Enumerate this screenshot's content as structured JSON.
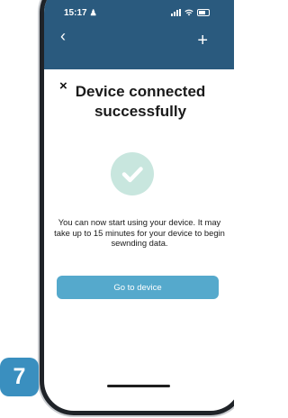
{
  "statusbar": {
    "time": "15:17",
    "person_glyph": "♟",
    "icons": [
      "signal-icon",
      "wifi-icon",
      "battery-icon"
    ]
  },
  "header": {
    "back_glyph": "‹",
    "add_glyph": "+",
    "background_color": "#2a5a7e"
  },
  "dialog": {
    "close_glyph": "×",
    "title": "Device connected successfully",
    "icon": "check-circle-icon",
    "icon_bg_color": "#c8e6de",
    "message": "You can now start using your device. It may take up to 15 minutes for your device to begin sewnding data.",
    "primary_button_label": "Go to device",
    "button_color": "#55a9cc"
  },
  "step_badge": {
    "label": "7",
    "color": "#3a8fbf"
  }
}
